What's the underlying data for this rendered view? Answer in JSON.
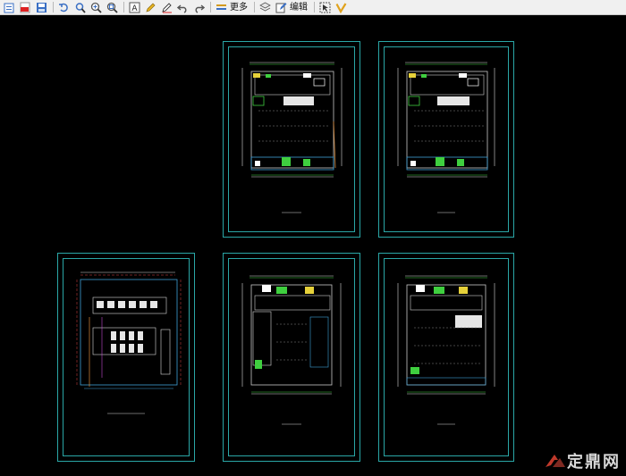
{
  "toolbar": {
    "more_label": "更多",
    "edit_label": "编辑"
  },
  "watermark": {
    "text": "定鼎网"
  }
}
